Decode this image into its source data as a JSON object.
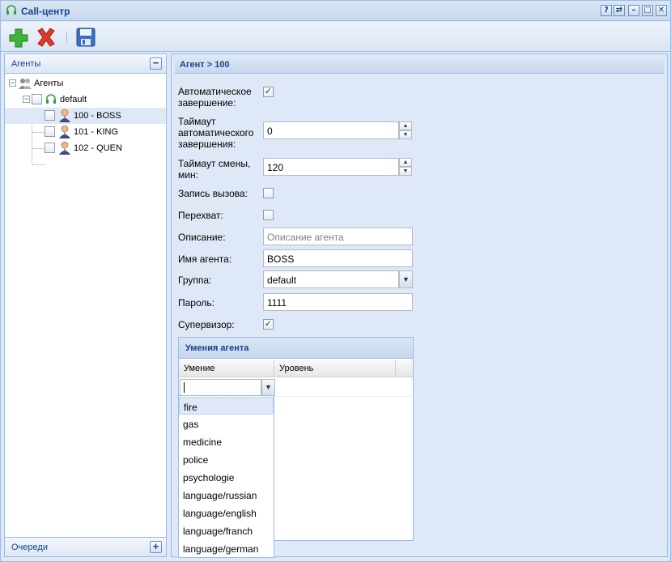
{
  "window": {
    "title": "Call-центр",
    "tools": [
      "?",
      "⇄",
      "–",
      "□",
      "✕"
    ]
  },
  "toolbar": {
    "add_icon": "plus-icon",
    "delete_icon": "delete-icon",
    "save_icon": "save-icon"
  },
  "left": {
    "header": "Агенты",
    "tree": {
      "root": "Агенты",
      "group": "default",
      "agents": [
        "100 - BOSS",
        "101 - KING",
        "102 - QUEN"
      ]
    },
    "bottom": "Очереди"
  },
  "form": {
    "title": "Агент > 100",
    "auto_complete_label": "Автоматическое завершение:",
    "auto_complete": true,
    "auto_timeout_label": "Таймаут автоматического завершения:",
    "auto_timeout": "0",
    "shift_timeout_label": "Таймаут смены, мин:",
    "shift_timeout": "120",
    "record_label": "Запись вызова:",
    "record": false,
    "intercept_label": "Перехват:",
    "intercept": false,
    "description_label": "Описание:",
    "description_placeholder": "Описание агента",
    "name_label": "Имя агента:",
    "name": "BOSS",
    "group_label": "Группа:",
    "group": "default",
    "password_label": "Пароль:",
    "password": "1111",
    "supervisor_label": "Супервизор:",
    "supervisor": true
  },
  "skills": {
    "title": "Умения агента",
    "col_skill": "Умение",
    "col_level": "Уровень",
    "editor_value": "",
    "options": [
      "fire",
      "gas",
      "medicine",
      "police",
      "psychologie",
      "language/russian",
      "language/english",
      "language/franch",
      "language/german"
    ],
    "highlighted": "fire"
  }
}
